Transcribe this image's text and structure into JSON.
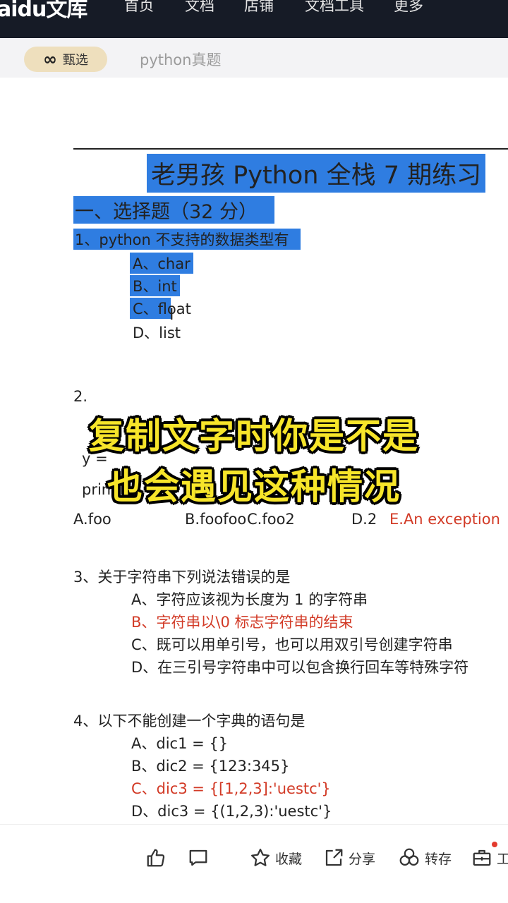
{
  "header": {
    "logo": "aidu文库",
    "nav": [
      "首页",
      "文档",
      "店铺",
      "文档工具",
      "更多"
    ]
  },
  "filter": {
    "pill_label": "甄选",
    "query": "python真题"
  },
  "doc": {
    "title": "老男孩 Python 全栈 7 期练习",
    "section": "一、选择题（32 分）",
    "q1": {
      "stem": "1、python 不支持的数据类型有",
      "options": [
        "A、char",
        "B、int",
        "C、float",
        "D、list"
      ]
    },
    "q2": {
      "num": "2.",
      "line_y": "y =",
      "line_print": "prin",
      "options": [
        "A.foo",
        "B.foofoo",
        "C.foo2",
        "D.2",
        "E.An  exception"
      ]
    },
    "q3": {
      "stem": "3、关于字符串下列说法错误的是",
      "options": [
        "A、字符应该视为长度为 1 的字符串",
        "B、字符串以\\0 标志字符串的结束",
        "C、既可以用单引号，也可以用双引号创建字符串",
        "D、在三引号字符串中可以包含换行回车等特殊字符"
      ]
    },
    "q4": {
      "stem": "4、以下不能创建一个字典的语句是",
      "options": [
        "A、dic1  =  {}",
        "B、dic2  =  {123:345}",
        "C、dic3  =  {[1,2,3]:'uestc'}",
        "D、dic3  =  {(1,2,3):'uestc'}"
      ]
    }
  },
  "overlay": {
    "line1": "复制文字时你是不是",
    "line2": "也会遇见这种情况"
  },
  "actions": {
    "like_icon": "thumbs-up-icon",
    "comment_icon": "comment-icon",
    "collect": "收藏",
    "share": "分享",
    "save": "转存",
    "tools": "工"
  },
  "colors": {
    "selection": "#2f7de1",
    "answer_red": "#d23a26",
    "overlay_yellow": "#f7e52a",
    "topbar": "#161b26"
  }
}
